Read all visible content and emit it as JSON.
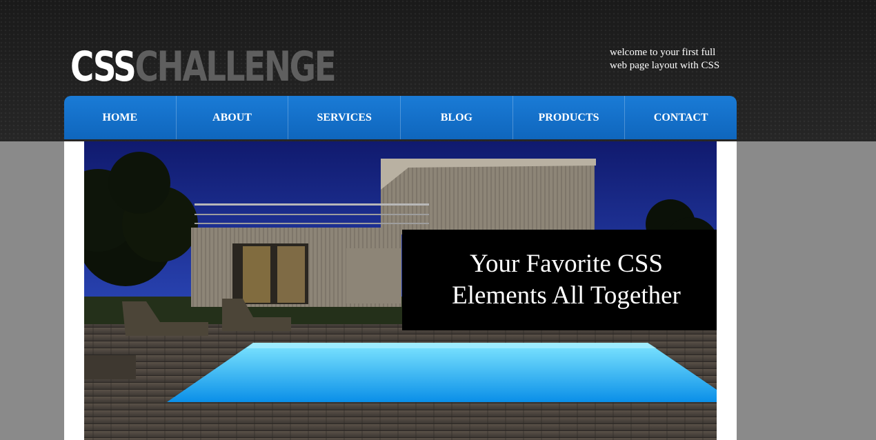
{
  "logo": {
    "part1": "CSS",
    "part2": "CHALLENGE"
  },
  "tagline": {
    "line1": "welcome to your first full",
    "line2": "web page layout with CSS"
  },
  "nav": {
    "items": [
      "HOME",
      "ABOUT",
      "SERVICES",
      "BLOG",
      "PRODUCTS",
      "CONTACT"
    ]
  },
  "hero": {
    "caption_line1": "Your Favorite CSS",
    "caption_line2": "Elements All Together"
  },
  "colors": {
    "nav_blue": "#1a7bd6",
    "page_gray": "#8a8a8a",
    "header_dark": "#1f1f1f"
  }
}
